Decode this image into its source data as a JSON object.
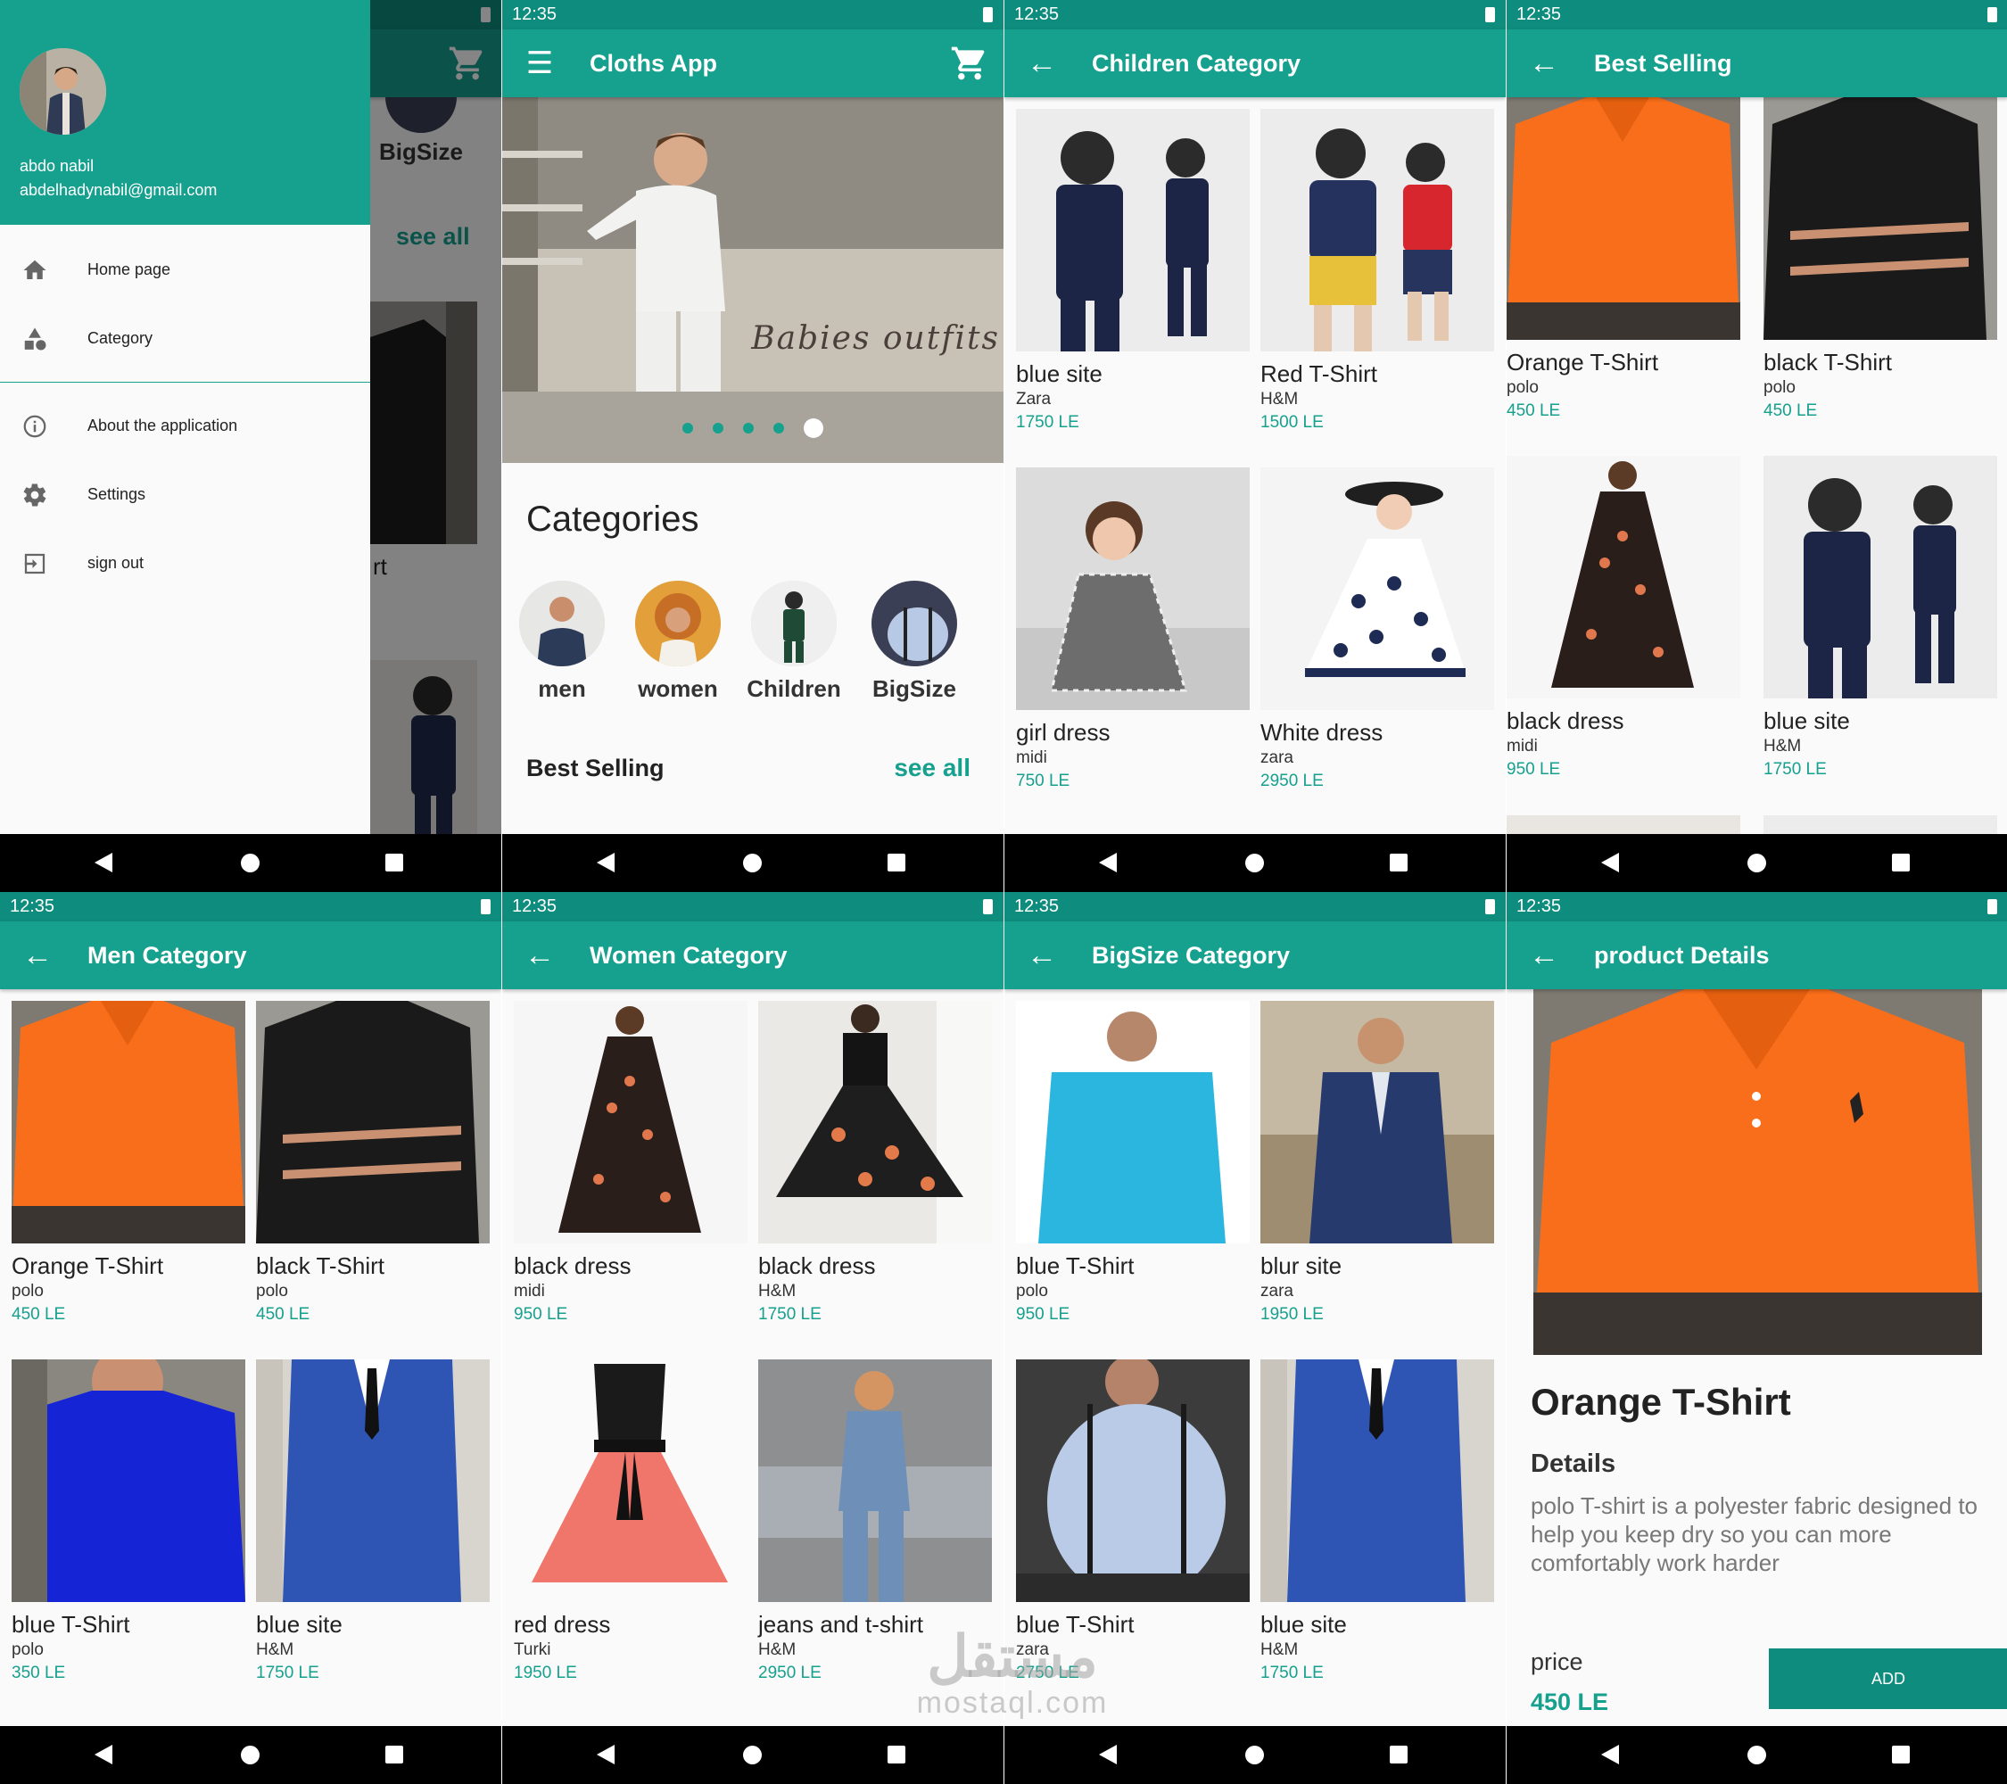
{
  "status": {
    "time": "12:35"
  },
  "drawer_screen": {
    "user_name": "abdo nabil",
    "user_email": "abdelhadynabil@gmail.com",
    "menu": [
      {
        "label": "Home page",
        "icon": "home-icon"
      },
      {
        "label": "Category",
        "icon": "category-icon"
      },
      {
        "label": "About the application",
        "icon": "info-icon"
      },
      {
        "label": "Settings",
        "icon": "gear-icon"
      },
      {
        "label": "sign out",
        "icon": "logout-icon"
      }
    ],
    "behind": {
      "bigsize": "BigSize",
      "see_all": "see all",
      "partial": "rt"
    }
  },
  "home_screen": {
    "title": "Cloths App",
    "banner_caption": "Babies outfits",
    "categories_title": "Categories",
    "categories": [
      {
        "label": "men"
      },
      {
        "label": "women"
      },
      {
        "label": "Children"
      },
      {
        "label": "BigSize"
      }
    ],
    "best_selling_title": "Best Selling",
    "see_all": "see all"
  },
  "children_screen": {
    "title": "Children Category",
    "products": [
      {
        "name": "blue site",
        "brand": "Zara",
        "price": "1750 LE"
      },
      {
        "name": "Red T-Shirt",
        "brand": "H&M",
        "price": "1500 LE"
      },
      {
        "name": "girl dress",
        "brand": "midi",
        "price": "750 LE"
      },
      {
        "name": "White dress",
        "brand": "zara",
        "price": "2950 LE"
      }
    ]
  },
  "best_screen": {
    "title": "Best Selling",
    "products": [
      {
        "name": "Orange T-Shirt",
        "brand": "polo",
        "price": "450 LE"
      },
      {
        "name": "black T-Shirt",
        "brand": "polo",
        "price": "450 LE"
      },
      {
        "name": "black dress",
        "brand": "midi",
        "price": "950 LE"
      },
      {
        "name": "blue site",
        "brand": "H&M",
        "price": "1750 LE"
      }
    ]
  },
  "men_screen": {
    "title": "Men Category",
    "products": [
      {
        "name": "Orange T-Shirt",
        "brand": "polo",
        "price": "450 LE"
      },
      {
        "name": "black T-Shirt",
        "brand": "polo",
        "price": "450 LE"
      },
      {
        "name": "blue T-Shirt",
        "brand": "polo",
        "price": "350 LE"
      },
      {
        "name": "blue site",
        "brand": "H&M",
        "price": "1750 LE"
      }
    ]
  },
  "women_screen": {
    "title": "Women Category",
    "products": [
      {
        "name": "black dress",
        "brand": "midi",
        "price": "950 LE"
      },
      {
        "name": "black dress",
        "brand": "H&M",
        "price": "1750 LE"
      },
      {
        "name": "red dress",
        "brand": "Turki",
        "price": "1950 LE"
      },
      {
        "name": "jeans and t-shirt",
        "brand": "H&M",
        "price": "2950 LE"
      }
    ]
  },
  "bigsize_screen": {
    "title": "BigSize Category",
    "products": [
      {
        "name": "blue T-Shirt",
        "brand": "polo",
        "price": "950 LE"
      },
      {
        "name": "blur site",
        "brand": "zara",
        "price": "1950 LE"
      },
      {
        "name": "blue T-Shirt",
        "brand": "zara",
        "price": "2750 LE"
      },
      {
        "name": "blue site",
        "brand": "H&M",
        "price": "1750 LE"
      }
    ]
  },
  "details_screen": {
    "title": "product Details",
    "product_name": "Orange T-Shirt",
    "details_heading": "Details",
    "description": "polo T-shirt is a polyester fabric designed to help you keep dry so you can more comfortably work harder",
    "price_label": "price",
    "price_value": "450 LE",
    "add_label": "ADD"
  },
  "watermark": {
    "arabic": "مستقل",
    "latin": "mostaql.com"
  },
  "colors": {
    "primary": "#16a08e",
    "primary_dark": "#0e8c7d"
  }
}
